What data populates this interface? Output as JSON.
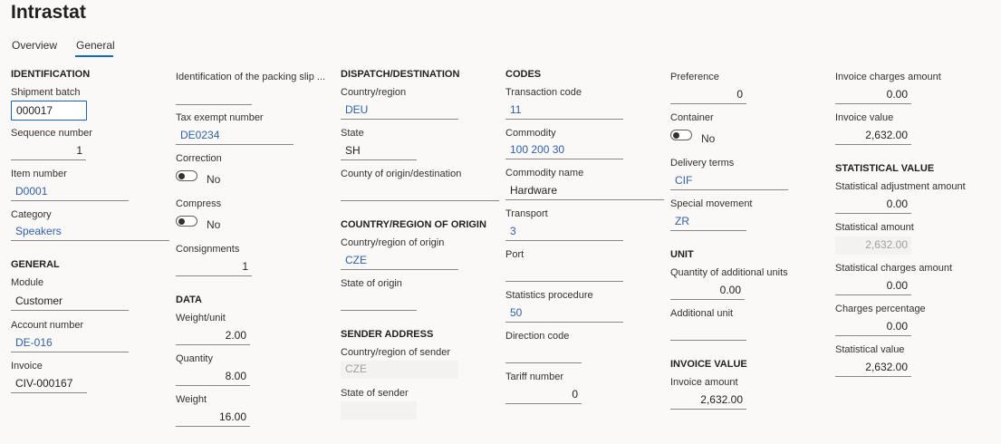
{
  "page": {
    "title": "Intrastat"
  },
  "tabs": [
    {
      "label": "Overview"
    },
    {
      "label": "General"
    }
  ],
  "identification": {
    "heading": "IDENTIFICATION",
    "shipment_batch": {
      "label": "Shipment batch",
      "value": "000017"
    },
    "sequence_number": {
      "label": "Sequence number",
      "value": "1"
    },
    "item_number": {
      "label": "Item number",
      "value": "D0001"
    },
    "category": {
      "label": "Category",
      "value": "Speakers"
    }
  },
  "general": {
    "heading": "GENERAL",
    "module": {
      "label": "Module",
      "value": "Customer"
    },
    "account_number": {
      "label": "Account number",
      "value": "DE-016"
    },
    "invoice": {
      "label": "Invoice",
      "value": "CIV-000167"
    }
  },
  "col2": {
    "packing_slip": {
      "label": "Identification of the packing slip ...",
      "value": ""
    },
    "tax_exempt": {
      "label": "Tax exempt number",
      "value": "DE0234"
    },
    "correction": {
      "label": "Correction",
      "state": "No"
    },
    "compress": {
      "label": "Compress",
      "state": "No"
    },
    "consignments": {
      "label": "Consignments",
      "value": "1"
    }
  },
  "data": {
    "heading": "DATA",
    "weight_unit": {
      "label": "Weight/unit",
      "value": "2.00"
    },
    "quantity": {
      "label": "Quantity",
      "value": "8.00"
    },
    "weight": {
      "label": "Weight",
      "value": "16.00"
    }
  },
  "dispatch": {
    "heading": "DISPATCH/DESTINATION",
    "country_region": {
      "label": "Country/region",
      "value": "DEU"
    },
    "state": {
      "label": "State",
      "value": "SH"
    },
    "county": {
      "label": "County of origin/destination",
      "value": ""
    }
  },
  "origin": {
    "heading": "COUNTRY/REGION OF ORIGIN",
    "country_region": {
      "label": "Country/region of origin",
      "value": "CZE"
    },
    "state": {
      "label": "State of origin",
      "value": ""
    }
  },
  "sender": {
    "heading": "SENDER ADDRESS",
    "country_region": {
      "label": "Country/region of sender",
      "value": "CZE"
    },
    "state": {
      "label": "State of sender",
      "value": ""
    }
  },
  "codes": {
    "heading": "CODES",
    "transaction_code": {
      "label": "Transaction code",
      "value": "11"
    },
    "commodity": {
      "label": "Commodity",
      "value": "100 200 30"
    },
    "commodity_name": {
      "label": "Commodity name",
      "value": "Hardware"
    },
    "transport": {
      "label": "Transport",
      "value": "3"
    },
    "port": {
      "label": "Port",
      "value": ""
    },
    "statistics_procedure": {
      "label": "Statistics procedure",
      "value": "50"
    },
    "direction_code": {
      "label": "Direction code",
      "value": ""
    },
    "tariff_number": {
      "label": "Tariff number",
      "value": "0"
    }
  },
  "col5": {
    "preference": {
      "label": "Preference",
      "value": "0"
    },
    "container": {
      "label": "Container",
      "state": "No"
    },
    "delivery_terms": {
      "label": "Delivery terms",
      "value": "CIF"
    },
    "special_movement": {
      "label": "Special movement",
      "value": "ZR"
    }
  },
  "unit": {
    "heading": "UNIT",
    "qty_additional": {
      "label": "Quantity of additional units",
      "value": "0.00"
    },
    "additional_unit": {
      "label": "Additional unit",
      "value": ""
    }
  },
  "invoice_value": {
    "heading": "INVOICE VALUE",
    "invoice_amount": {
      "label": "Invoice amount",
      "value": "2,632.00"
    }
  },
  "col6": {
    "invoice_charges": {
      "label": "Invoice charges amount",
      "value": "0.00"
    },
    "invoice_value": {
      "label": "Invoice value",
      "value": "2,632.00"
    }
  },
  "statistical": {
    "heading": "STATISTICAL VALUE",
    "adjustment_amount": {
      "label": "Statistical adjustment amount",
      "value": "0.00"
    },
    "amount": {
      "label": "Statistical amount",
      "value": "2,632.00"
    },
    "charges_amount": {
      "label": "Statistical charges amount",
      "value": "0.00"
    },
    "charges_percentage": {
      "label": "Charges percentage",
      "value": "0.00"
    },
    "value": {
      "label": "Statistical value",
      "value": "2,632.00"
    }
  },
  "colors": {
    "accent": "#0f6cbd",
    "link": "#2f5fa7",
    "background": "#faf9f8"
  }
}
